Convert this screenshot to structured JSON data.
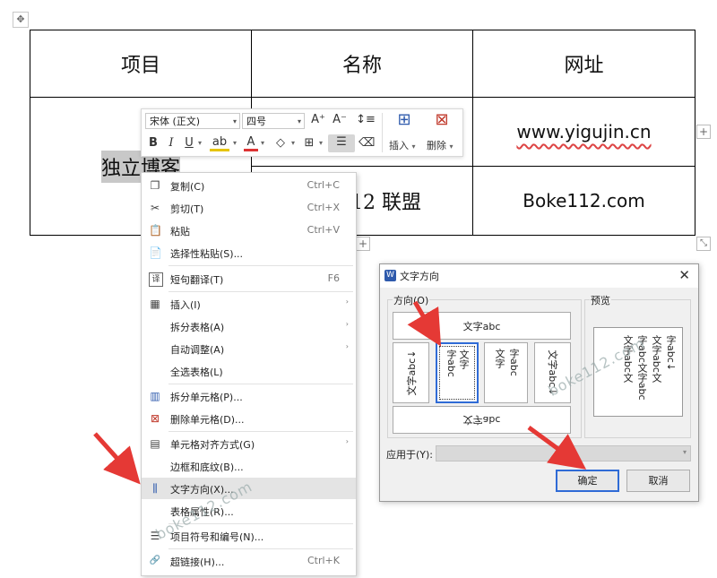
{
  "table": {
    "headers": [
      "项目",
      "名称",
      "网址"
    ],
    "row1": {
      "c1": "独立博客",
      "c3": "www.yigujin.cn"
    },
    "row2": {
      "c2": "12 联盟",
      "c3": "Boke112.com"
    },
    "plus_symbol": "+",
    "move_symbol": "✥",
    "resize_symbol": "⤡"
  },
  "toolbar": {
    "font_name": "宋体 (正文)",
    "font_size": "四号",
    "grow_font": "A⁺",
    "shrink_font": "A⁻",
    "line_spacing": "↕≡",
    "bold": "B",
    "italic": "I",
    "underline": "U",
    "highlight": "ab",
    "font_color": "A",
    "shading": "◇",
    "borders": "⊞",
    "align": "☰",
    "eraser": "⌫",
    "insert_icon": "⊞",
    "insert_label": "插入",
    "delete_icon": "⊠",
    "delete_label": "删除",
    "dropdown": "▾"
  },
  "context_menu": {
    "copy": {
      "icon": "❐",
      "label": "复制(C)",
      "shortcut": "Ctrl+C"
    },
    "cut": {
      "icon": "✂",
      "label": "剪切(T)",
      "shortcut": "Ctrl+X"
    },
    "paste": {
      "icon": "📋",
      "label": "粘贴",
      "shortcut": "Ctrl+V"
    },
    "paste_special": {
      "icon": "📄",
      "label": "选择性粘贴(S)..."
    },
    "translate": {
      "icon": "译",
      "label": "短句翻译(T)",
      "shortcut": "F6"
    },
    "insert": {
      "icon": "▦",
      "label": "插入(I)",
      "submenu": "›"
    },
    "split_table": {
      "label": "拆分表格(A)",
      "submenu": "›"
    },
    "autofit": {
      "label": "自动调整(A)",
      "submenu": "›"
    },
    "select_table": {
      "label": "全选表格(L)"
    },
    "split_cells": {
      "icon": "▥",
      "label": "拆分单元格(P)..."
    },
    "delete_cells": {
      "icon": "⊠",
      "label": "删除单元格(D)..."
    },
    "cell_align": {
      "icon": "▤",
      "label": "单元格对齐方式(G)",
      "submenu": "›"
    },
    "borders_shading": {
      "label": "边框和底纹(B)..."
    },
    "text_direction": {
      "icon": "⫼",
      "label": "文字方向(X)..."
    },
    "table_props": {
      "label": "表格属性(R)..."
    },
    "bullets": {
      "icon": "☰",
      "label": "项目符号和编号(N)..."
    },
    "hyperlink": {
      "icon": "🔗",
      "label": "超链接(H)...",
      "shortcut": "Ctrl+K"
    }
  },
  "dialog": {
    "app_icon": "W",
    "title": "文字方向",
    "close": "✕",
    "direction_label": "方向(O)",
    "preview_label": "预览",
    "options": {
      "horizontal": "文字abc",
      "rot_left": "文字abc↓",
      "vert_a1": "文字",
      "vert_a2": "字abc",
      "vert_b1": "文字",
      "vert_b2": "字abc",
      "rot_right": "文字abc↓",
      "flip": "文字abc"
    },
    "preview_lines": [
      "字abc↓",
      "文字abc文",
      "字abc文字abc",
      "文字abc文"
    ],
    "apply_label": "应用于(Y):",
    "apply_value": "",
    "ok": "确定",
    "cancel": "取消"
  },
  "watermarks": [
    "boke112.com",
    "boke112.com",
    "boke112.com"
  ],
  "colors": {
    "arrow": "#e53935",
    "selection_blue": "#2f6bd6"
  }
}
